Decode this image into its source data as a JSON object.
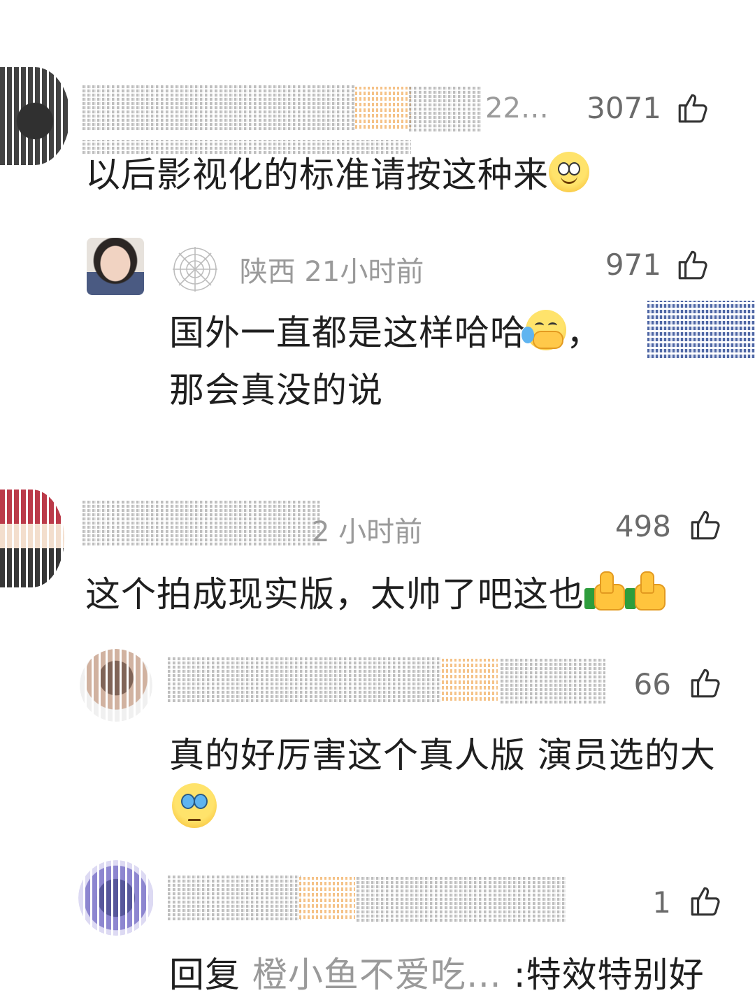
{
  "comments": [
    {
      "meta": "22…",
      "likes": "3071",
      "text": "以后影视化的标准请按这种来",
      "emoji": "smile-emoji"
    },
    {
      "reply": true,
      "location": "陕西 21小时前",
      "likes": "971",
      "text_line1": "国外一直都是这样哈哈",
      "text_line1_suffix": "，",
      "text_line2": "那会真没的说",
      "emoji": "laugh-cry-emoji"
    },
    {
      "meta": "2 小时前",
      "likes": "498",
      "text": "这个拍成现实版，太帅了吧这也",
      "emoji": "thumbs-up-emoji"
    },
    {
      "reply": true,
      "likes": "66",
      "text": "真的好厉害这个真人版 演员选的大",
      "emoji": "pleading-emoji"
    },
    {
      "reply": true,
      "likes": "1",
      "text_prefix": "回复 ",
      "text_mention": "橙小鱼不爱吃…",
      "text": " :特效特别好"
    }
  ],
  "icons": {
    "like": "thumbs-up-outline-icon",
    "web_badge": "spider-web-icon"
  },
  "colors": {
    "text": "#1f1f1f",
    "muted": "#9a9a9a",
    "count": "#6a6a6a"
  }
}
